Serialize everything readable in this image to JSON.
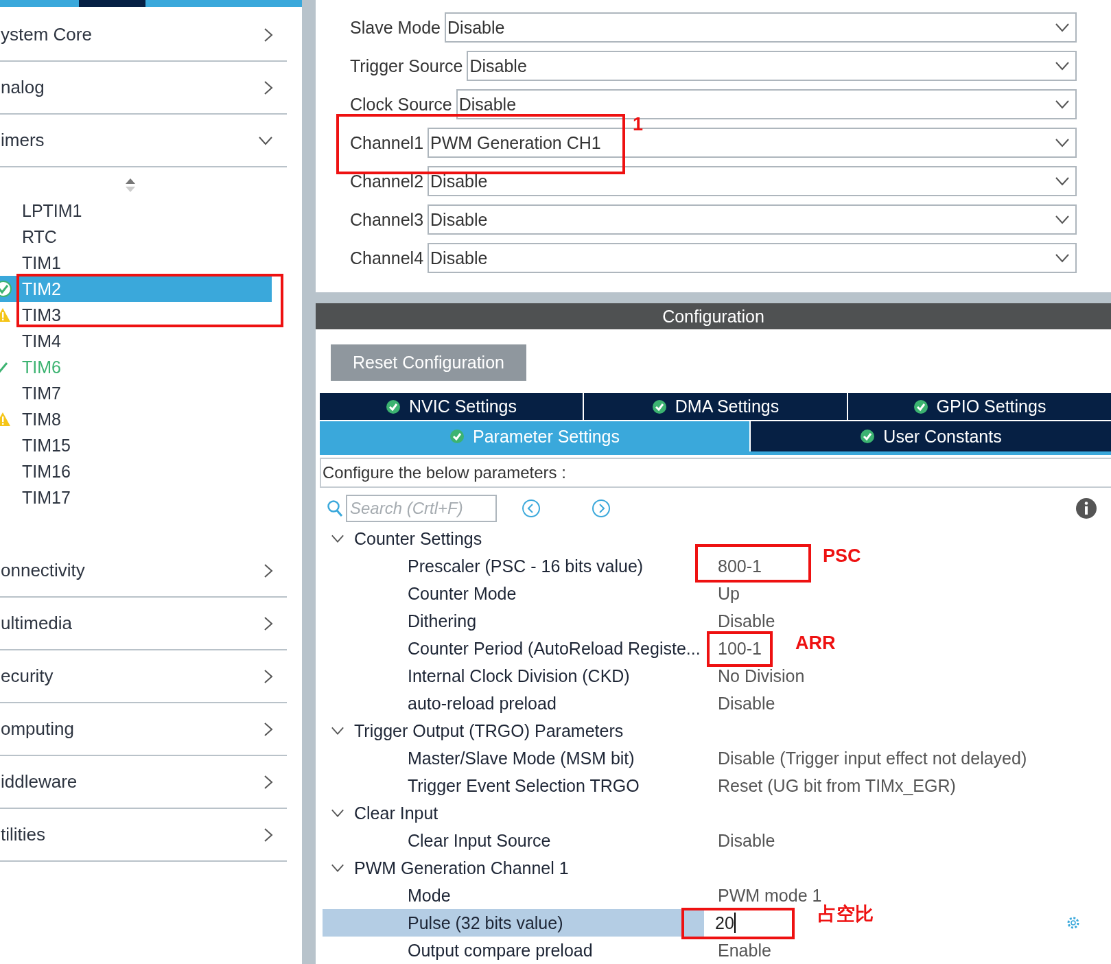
{
  "sidebar": {
    "categories": [
      {
        "label": "ystem Core",
        "expanded": false
      },
      {
        "label": "nalog",
        "expanded": false
      },
      {
        "label": "imers",
        "expanded": true,
        "items": [
          {
            "label": "LPTIM1",
            "kind": "none",
            "selected": false
          },
          {
            "label": "RTC",
            "kind": "none",
            "selected": false
          },
          {
            "label": "TIM1",
            "kind": "none",
            "selected": false
          },
          {
            "label": "TIM2",
            "kind": "ok",
            "selected": true
          },
          {
            "label": "TIM3",
            "kind": "warning",
            "selected": false
          },
          {
            "label": "TIM4",
            "kind": "none",
            "selected": false
          },
          {
            "label": "TIM6",
            "kind": "enabled",
            "selected": false
          },
          {
            "label": "TIM7",
            "kind": "none",
            "selected": false
          },
          {
            "label": "TIM8",
            "kind": "warning",
            "selected": false
          },
          {
            "label": "TIM15",
            "kind": "none",
            "selected": false
          },
          {
            "label": "TIM16",
            "kind": "none",
            "selected": false
          },
          {
            "label": "TIM17",
            "kind": "none",
            "selected": false
          }
        ]
      },
      {
        "label": "onnectivity",
        "expanded": false
      },
      {
        "label": "ultimedia",
        "expanded": false
      },
      {
        "label": "ecurity",
        "expanded": false
      },
      {
        "label": "omputing",
        "expanded": false
      },
      {
        "label": "iddleware",
        "expanded": false
      },
      {
        "label": "tilities",
        "expanded": false
      }
    ]
  },
  "mode": {
    "fields": [
      {
        "label": "Slave Mode",
        "value": "Disable"
      },
      {
        "label": "Trigger Source",
        "value": "Disable"
      },
      {
        "label": "Clock Source",
        "value": "Disable"
      },
      {
        "label": "Channel1",
        "value": "PWM Generation CH1"
      },
      {
        "label": "Channel2",
        "value": "Disable"
      },
      {
        "label": "Channel3",
        "value": "Disable"
      },
      {
        "label": "Channel4",
        "value": "Disable"
      }
    ]
  },
  "configuration": {
    "title": "Configuration",
    "reset_button": "Reset Configuration",
    "tabs": [
      [
        {
          "label": "NVIC Settings",
          "selected": false
        },
        {
          "label": "DMA Settings",
          "selected": false
        },
        {
          "label": "GPIO Settings",
          "selected": false
        }
      ],
      [
        {
          "label": "Parameter Settings",
          "selected": true
        },
        {
          "label": "User Constants",
          "selected": false
        }
      ]
    ],
    "intro": "Configure the below parameters :",
    "search": {
      "placeholder": "Search (Crtl+F)"
    },
    "groups": [
      {
        "title": "Counter Settings",
        "expanded": true,
        "children": [
          {
            "label": "Prescaler (PSC - 16 bits value)",
            "value": "800-1",
            "selected": false
          },
          {
            "label": "Counter Mode",
            "value": "Up",
            "selected": false
          },
          {
            "label": "Dithering",
            "value": "Disable",
            "selected": false
          },
          {
            "label": "Counter Period (AutoReload Registe...",
            "value": "100-1",
            "selected": false
          },
          {
            "label": "Internal Clock Division (CKD)",
            "value": "No Division",
            "selected": false
          },
          {
            "label": "auto-reload preload",
            "value": "Disable",
            "selected": false
          }
        ]
      },
      {
        "title": "Trigger Output (TRGO) Parameters",
        "expanded": true,
        "children": [
          {
            "label": "Master/Slave Mode (MSM bit)",
            "value": "Disable (Trigger input effect not delayed)",
            "selected": false
          },
          {
            "label": "Trigger Event Selection TRGO",
            "value": "Reset (UG bit from TIMx_EGR)",
            "selected": false
          }
        ]
      },
      {
        "title": "Clear Input",
        "expanded": true,
        "children": [
          {
            "label": "Clear Input Source",
            "value": "Disable",
            "selected": false
          }
        ]
      },
      {
        "title": "PWM Generation Channel 1",
        "expanded": true,
        "children": [
          {
            "label": "Mode",
            "value": "PWM mode 1",
            "selected": false
          },
          {
            "label": "Pulse (32 bits value)",
            "value": "20",
            "selected": true
          },
          {
            "label": "Output compare preload",
            "value": "Enable",
            "selected": false
          }
        ]
      }
    ]
  },
  "annotations": [
    {
      "kind": "box"
    },
    {
      "kind": "label",
      "text": "1"
    },
    {
      "kind": "box"
    },
    {
      "kind": "box"
    },
    {
      "kind": "label",
      "text": "PSC"
    },
    {
      "kind": "box"
    },
    {
      "kind": "label",
      "text": "ARR"
    },
    {
      "kind": "box"
    },
    {
      "kind": "label",
      "text": "占空比"
    }
  ]
}
